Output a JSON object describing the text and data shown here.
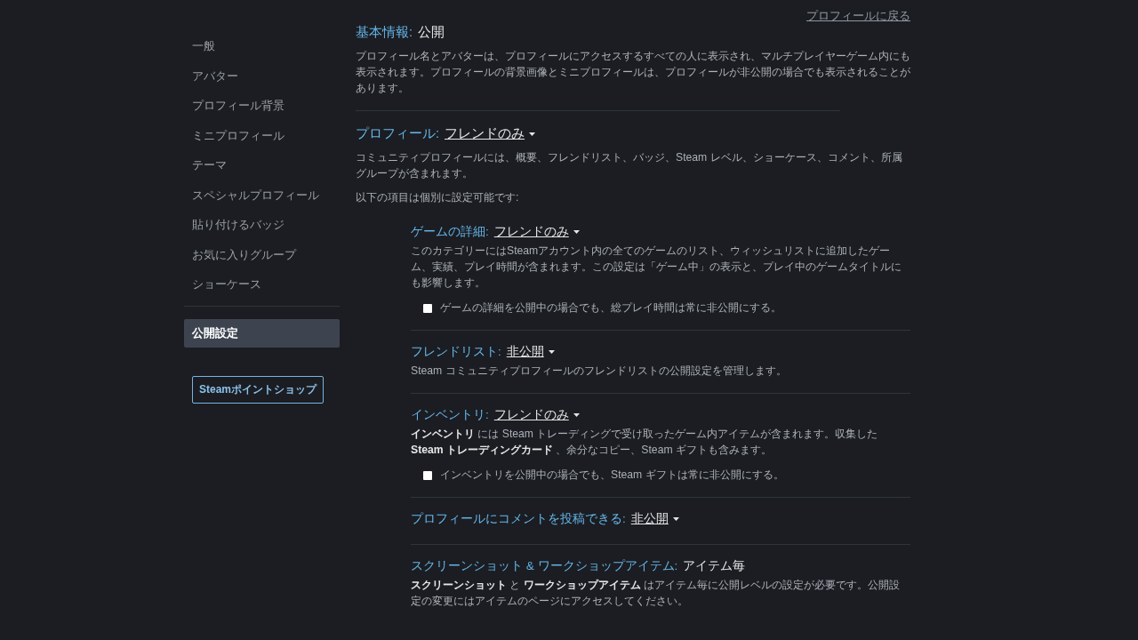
{
  "back_link": "プロフィールに戻る",
  "sidebar": {
    "items": [
      {
        "label": "一般",
        "selected": false
      },
      {
        "label": "アバター",
        "selected": false
      },
      {
        "label": "プロフィール背景",
        "selected": false
      },
      {
        "label": "ミニプロフィール",
        "selected": false
      },
      {
        "label": "テーマ",
        "selected": false
      },
      {
        "label": "スペシャルプロフィール",
        "selected": false
      },
      {
        "label": "貼り付けるバッジ",
        "selected": false
      },
      {
        "label": "お気に入りグループ",
        "selected": false
      },
      {
        "label": "ショーケース",
        "selected": false
      },
      {
        "label": "公開設定",
        "selected": true
      }
    ],
    "shop_button": "Steamポイントショップ"
  },
  "sections": [
    {
      "label": "基本情報:",
      "kind": "static",
      "value": "公開",
      "paragraphs": [
        "プロフィール名とアバターは、プロフィールにアクセスするすべての人に表示され、マルチプレイヤーゲーム内にも表示されます。プロフィールの背景画像とミニプロフィールは、プロフィールが非公開の場合でも表示されることがあります。"
      ]
    },
    {
      "label": "プロフィール:",
      "kind": "dropdown",
      "value": "フレンドのみ",
      "paragraphs": [
        "コミュニティプロフィールには、概要、フレンドリスト、バッジ、Steam レベル、ショーケース、コメント、所属グループが含まれます。",
        "以下の項目は個別に設定可能です:"
      ]
    }
  ],
  "subsections": [
    {
      "label": "ゲームの詳細:",
      "kind": "dropdown",
      "value": "フレンドのみ",
      "description": "このカテゴリーにはSteamアカウント内の全てのゲームのリスト、ウィッシュリストに追加したゲーム、実績、プレイ時間が含まれます。この設定は「ゲーム中」の表示と、プレイ中のゲームタイトルにも影響します。",
      "checkbox": {
        "label": "ゲームの詳細を公開中の場合でも、総プレイ時間は常に非公開にする。",
        "checked": false
      }
    },
    {
      "label": "フレンドリスト:",
      "kind": "dropdown",
      "value": "非公開",
      "description": "Steam コミュニティプロフィールのフレンドリストの公開設定を管理します。"
    },
    {
      "label": "インベントリ:",
      "kind": "dropdown",
      "value": "フレンドのみ",
      "description": "**インベントリ** には Steam トレーディングで受け取ったゲーム内アイテムが含まれます。収集した **Steam トレーディングカード** 、余分なコピー、Steam ギフトも含みます。",
      "checkbox": {
        "label": "インベントリを公開中の場合でも、Steam ギフトは常に非公開にする。",
        "checked": false
      }
    },
    {
      "label": "プロフィールにコメントを投稿できる:",
      "kind": "dropdown",
      "value": "非公開"
    },
    {
      "label": "スクリーンショット & ワークショップアイテム:",
      "kind": "static",
      "value": "アイテム毎",
      "description": "**スクリーンショット** と **ワークショップアイテム** はアイテム毎に公開レベルの設定が必要です。公開設定の変更にはアイテムのページにアクセスしてください。"
    }
  ]
}
